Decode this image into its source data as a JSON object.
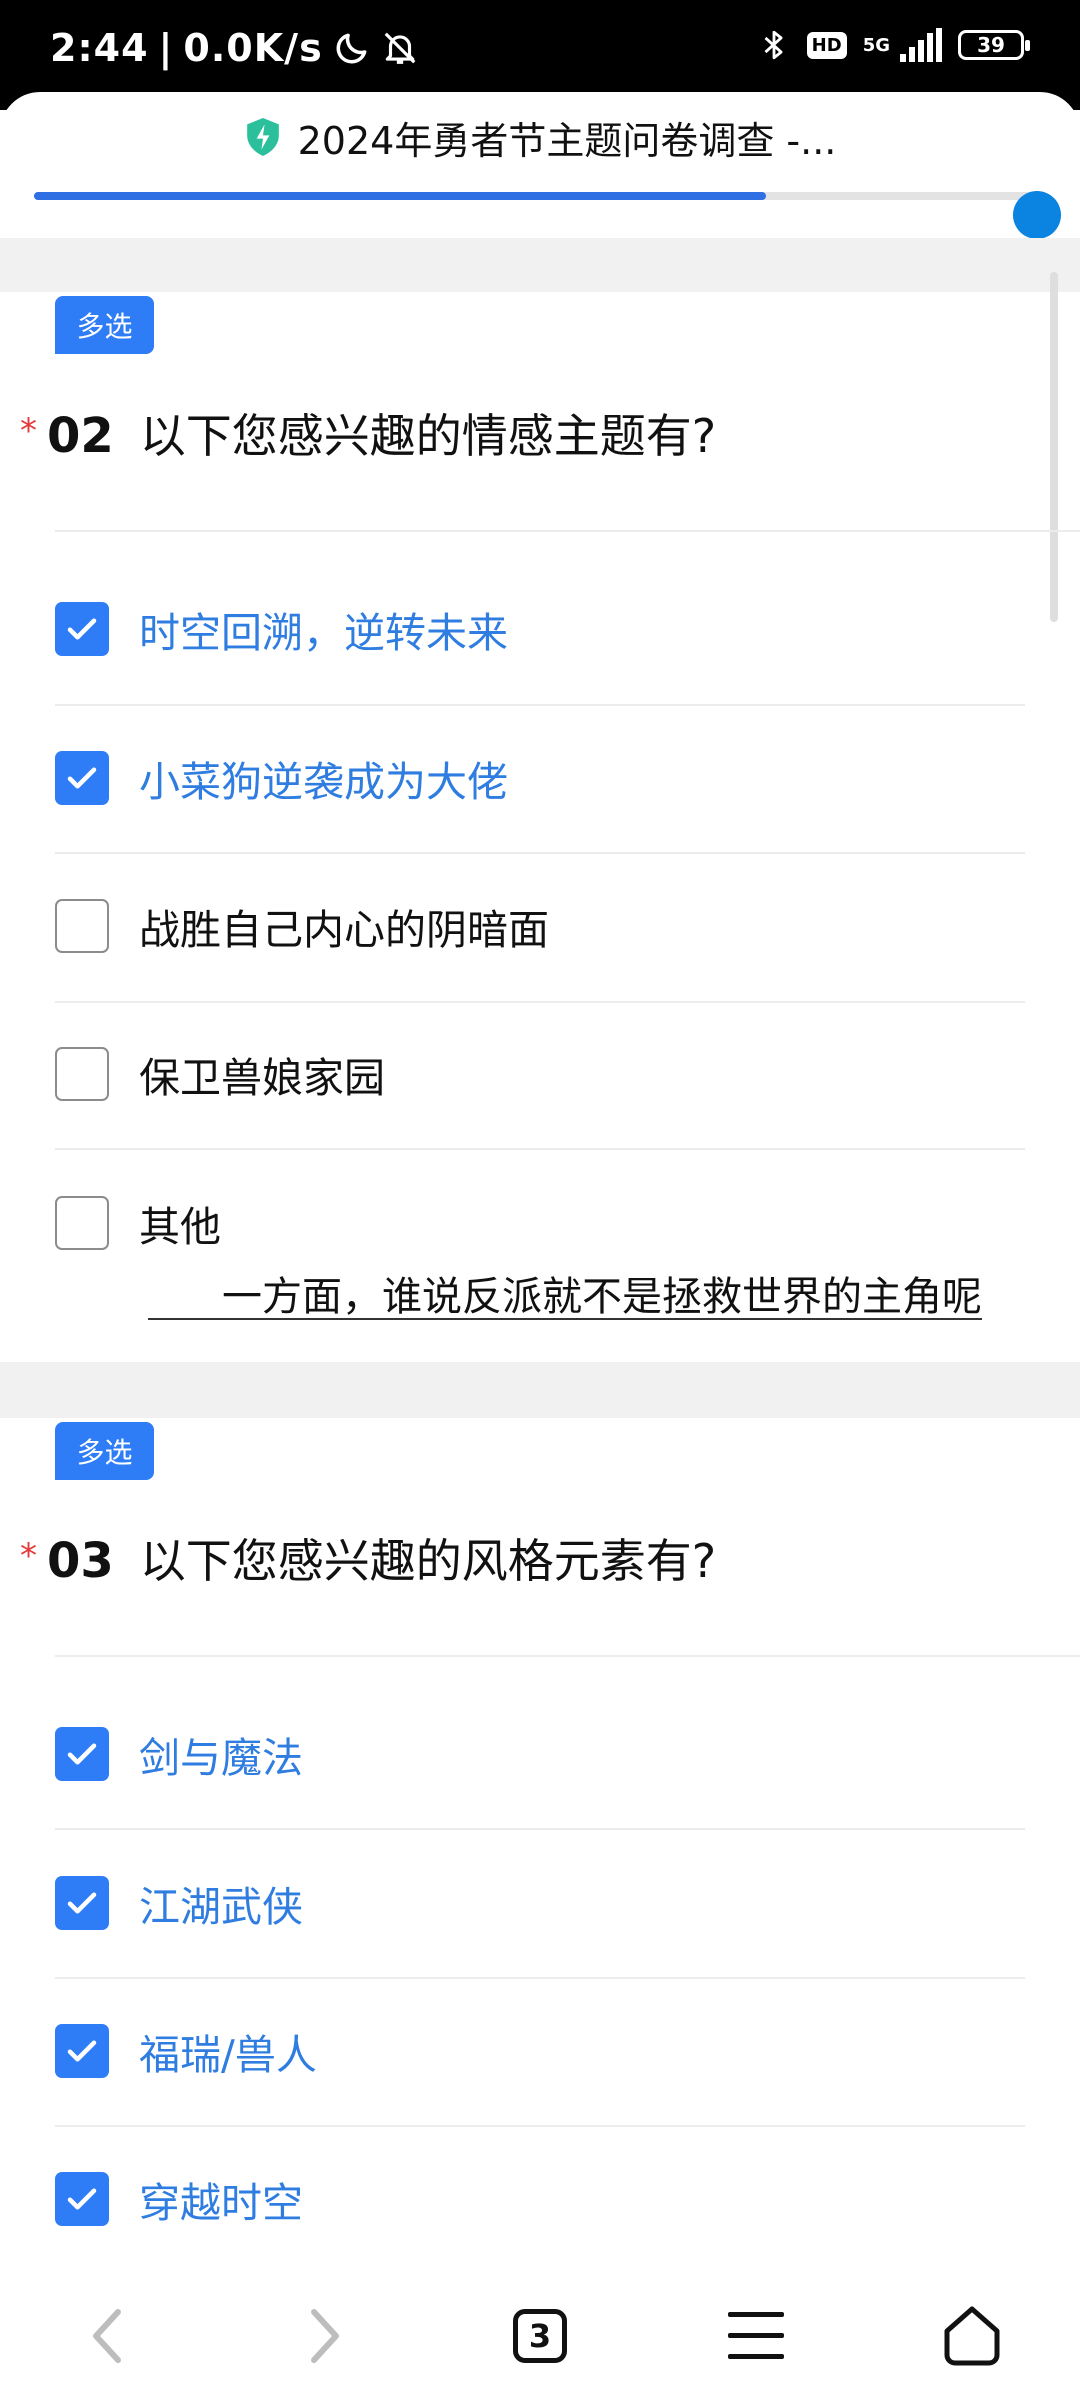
{
  "status_bar": {
    "time": "2:44",
    "separator": "|",
    "net_speed": "0.0K/s",
    "network_gen": "5G",
    "hd_label": "HD",
    "battery": "39",
    "icons": [
      "moon-icon",
      "bell-off-icon",
      "bluetooth-icon",
      "signal-icon",
      "battery-icon"
    ]
  },
  "browser": {
    "title": "2024年勇者节主题问卷调查 -...",
    "progress": 0.725,
    "tabs_count": "3",
    "accent": "#2e7cf6"
  },
  "questions": [
    {
      "tag": "多选",
      "required_mark": "*",
      "number": "02",
      "text": "以下您感兴趣的情感主题有?",
      "options": [
        {
          "label": "时空回溯，逆转未来",
          "checked": true
        },
        {
          "label": "小菜狗逆袭成为大佬",
          "checked": true
        },
        {
          "label": "战胜自己内心的阴暗面",
          "checked": false
        },
        {
          "label": "保卫兽娘家园",
          "checked": false
        },
        {
          "label": "其他",
          "checked": false
        }
      ],
      "other_value": "一方面，谁说反派就不是拯救世界的主角呢"
    },
    {
      "tag": "多选",
      "required_mark": "*",
      "number": "03",
      "text": "以下您感兴趣的风格元素有?",
      "options": [
        {
          "label": "剑与魔法",
          "checked": true
        },
        {
          "label": "江湖武侠",
          "checked": true
        },
        {
          "label": "福瑞/兽人",
          "checked": true
        },
        {
          "label": "穿越时空",
          "checked": true
        }
      ]
    }
  ]
}
